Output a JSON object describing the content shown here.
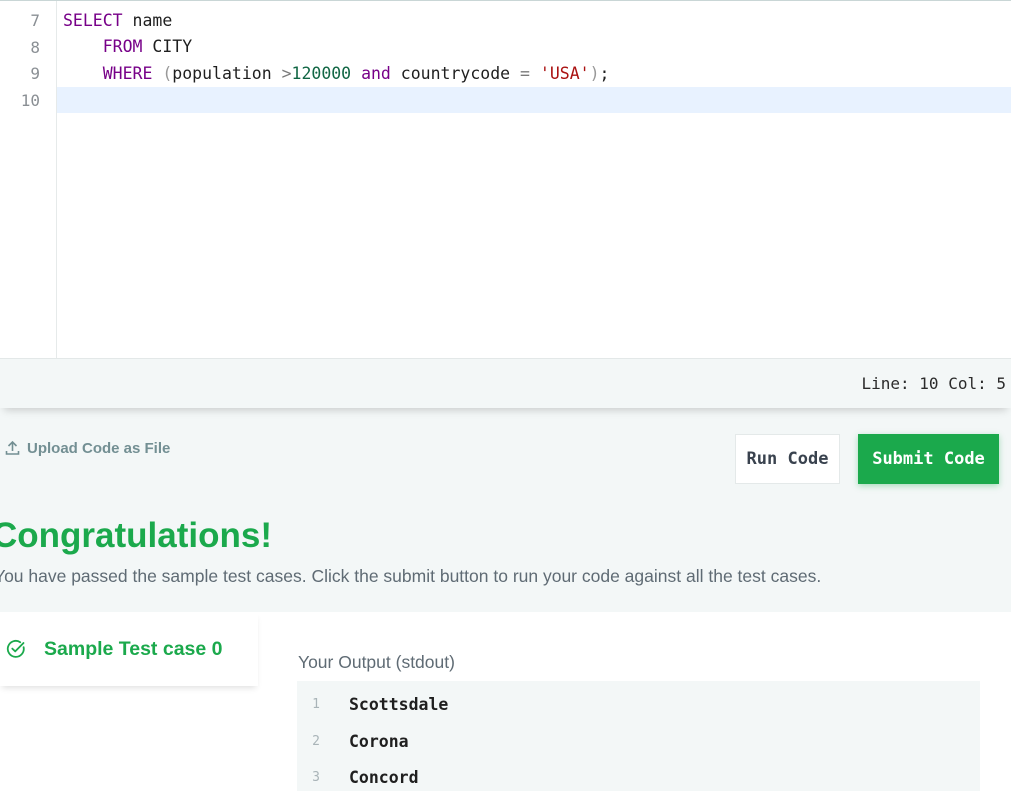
{
  "editor": {
    "line_numbers": [
      "7",
      "8",
      "9",
      "10"
    ],
    "lines": [
      {
        "tokens": [
          {
            "t": "SELECT",
            "c": "kw"
          },
          {
            "t": " name",
            "c": ""
          }
        ]
      },
      {
        "tokens": [
          {
            "t": "    ",
            "c": ""
          },
          {
            "t": "FROM",
            "c": "kw"
          },
          {
            "t": " CITY",
            "c": ""
          }
        ]
      },
      {
        "tokens": [
          {
            "t": "    ",
            "c": ""
          },
          {
            "t": "WHERE",
            "c": "kw"
          },
          {
            "t": " ",
            "c": ""
          },
          {
            "t": "(",
            "c": "bracket"
          },
          {
            "t": "population",
            "c": ""
          },
          {
            "t": " ",
            "c": ""
          },
          {
            "t": ">",
            "c": "op"
          },
          {
            "t": "120000",
            "c": "num"
          },
          {
            "t": " ",
            "c": ""
          },
          {
            "t": "and",
            "c": "kw"
          },
          {
            "t": " countrycode ",
            "c": ""
          },
          {
            "t": "=",
            "c": "op"
          },
          {
            "t": " ",
            "c": ""
          },
          {
            "t": "'USA'",
            "c": "str"
          },
          {
            "t": ")",
            "c": "bracket"
          },
          {
            "t": ";",
            "c": ""
          }
        ]
      },
      {
        "tokens": []
      }
    ],
    "active_line_index": 3
  },
  "status": {
    "text": "Line: 10 Col: 5"
  },
  "actions": {
    "upload_label": "Upload Code as File",
    "run_label": "Run Code",
    "submit_label": "Submit Code"
  },
  "result": {
    "title": "Congratulations!",
    "message": "You have passed the sample test cases. Click the submit button to run your code against all the test cases."
  },
  "testcase": {
    "label": "Sample Test case 0"
  },
  "output": {
    "title": "Your Output (stdout)",
    "rows": [
      {
        "num": "1",
        "value": "Scottsdale"
      },
      {
        "num": "2",
        "value": "Corona"
      },
      {
        "num": "3",
        "value": "Concord"
      }
    ]
  },
  "colors": {
    "accent_green": "#1ba94c",
    "keyword": "#770088",
    "number": "#116644",
    "string": "#aa1111",
    "active_line": "#e8f2ff"
  }
}
